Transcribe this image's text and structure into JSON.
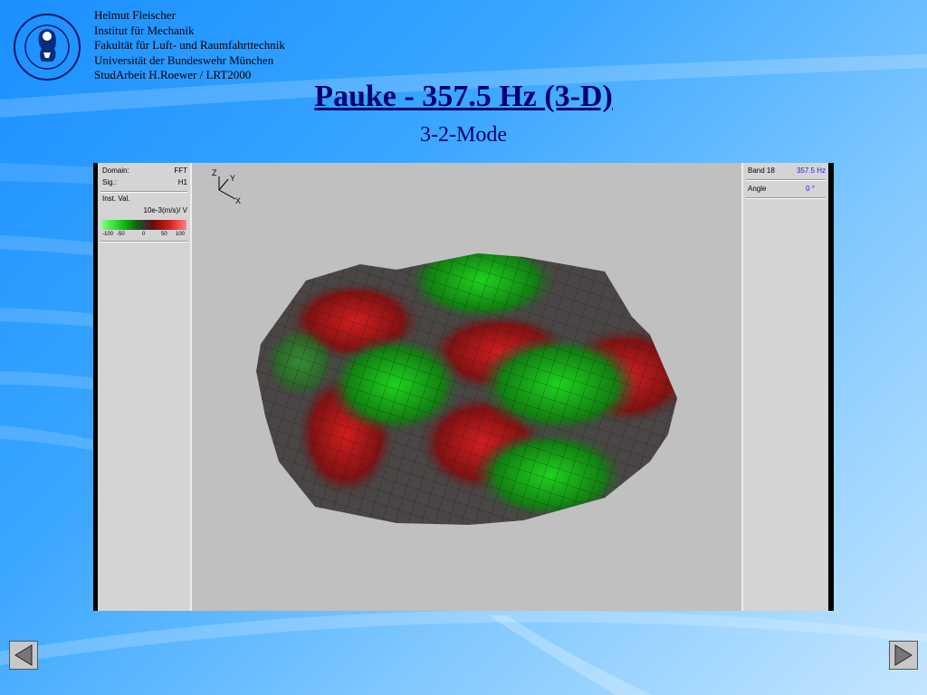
{
  "header": {
    "lines": [
      "Helmut Fleischer",
      "Institut für Mechanik",
      "Fakultät für Luft- und Raumfahrttechnik",
      "Universität der Bundeswehr München",
      "StudArbeit H.Roewer / LRT2000"
    ],
    "seal_text": "UNIVERSITÄT DER BUNDESWEHR MÜNCHEN"
  },
  "title": "Pauke - 357.5 Hz (3-D)",
  "subtitle": "3-2-Mode",
  "left_panel": {
    "domain_label": "Domain:",
    "domain_value": "FFT",
    "sig_label": "Sig.:",
    "sig_value": "H1",
    "inst_label": "Inst. Val.",
    "unit": "10e-3(m/s)/ V",
    "scale_ticks": [
      "-100",
      "-50",
      "0",
      "50",
      "100"
    ]
  },
  "right_panel": {
    "band_label": "Band 18",
    "band_value": "357.5 Hz",
    "angle_label": "Angle",
    "angle_value": "0 °"
  },
  "axes": {
    "z": "Z",
    "y": "Y",
    "x": "X"
  },
  "colors": {
    "title": "#00006e",
    "positive": "#c82020",
    "negative": "#20b020",
    "value_text": "#1a1aff"
  },
  "nav": {
    "prev_icon": "triangle-left-icon",
    "next_icon": "triangle-right-icon"
  }
}
